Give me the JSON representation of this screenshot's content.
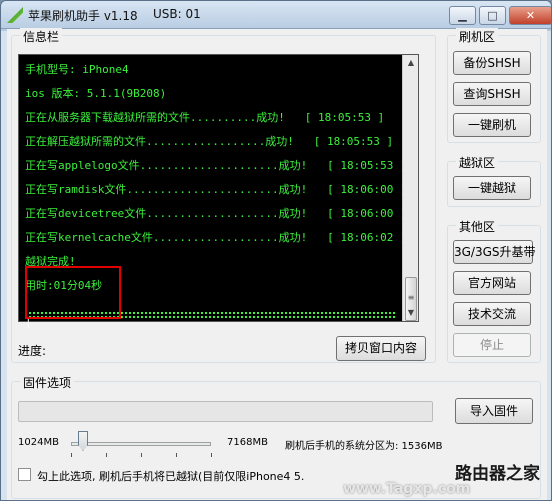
{
  "window": {
    "title": "苹果刷机助手 v1.18",
    "usb_label": "USB: 01",
    "minimize_glyph": "▁",
    "maximize_glyph": "□",
    "close_glyph": "✕"
  },
  "info": {
    "group_title": "信息栏",
    "lines": [
      "手机型号: iPhone4",
      "ios 版本: 5.1.1(9B208)",
      "正在从服务器下载越狱所需的文件..........成功!   [ 18:05:53 ]",
      "正在解压越狱所需的文件..................成功!   [ 18:05:53 ]",
      "正在写applelogo文件.....................成功!   [ 18:05:53 ]",
      "正在写ramdisk文件.......................成功!   [ 18:06:00 ]",
      "正在写devicetree文件....................成功!   [ 18:06:00 ]",
      "正在写kernelcache文件...................成功!   [ 18:06:02 ]",
      "越狱完成!",
      "用时:01分04秒"
    ],
    "cursor": "|"
  },
  "progress": {
    "label": "进度:",
    "copy_button": "拷贝窗口内容"
  },
  "flash_group": {
    "title": "刷机区",
    "buttons": [
      "备份SHSH",
      "查询SHSH",
      "一键刷机"
    ]
  },
  "jailbreak_group": {
    "title": "越狱区",
    "buttons": [
      "一键越狱"
    ]
  },
  "other_group": {
    "title": "其他区",
    "buttons": [
      "3G/3GS升基带",
      "官方网站",
      "技术交流",
      "停止"
    ]
  },
  "firmware": {
    "title": "固件选项",
    "import_button": "导入固件",
    "slider_min": "1024MB",
    "slider_max": "7168MB",
    "partition_text": "刷机后手机的系统分区为: 1536MB",
    "checkbox_label": "勾上此选项, 刷机后手机将已越狱(目前仅限iPhone4 5.",
    "slider_value": 1536
  },
  "watermark": {
    "text_1": "路由器之家",
    "text_2": "www.Tagxp.com"
  },
  "colors": {
    "console_text": "#3cf03c",
    "console_bg": "#000000",
    "highlight": "#e00000"
  }
}
